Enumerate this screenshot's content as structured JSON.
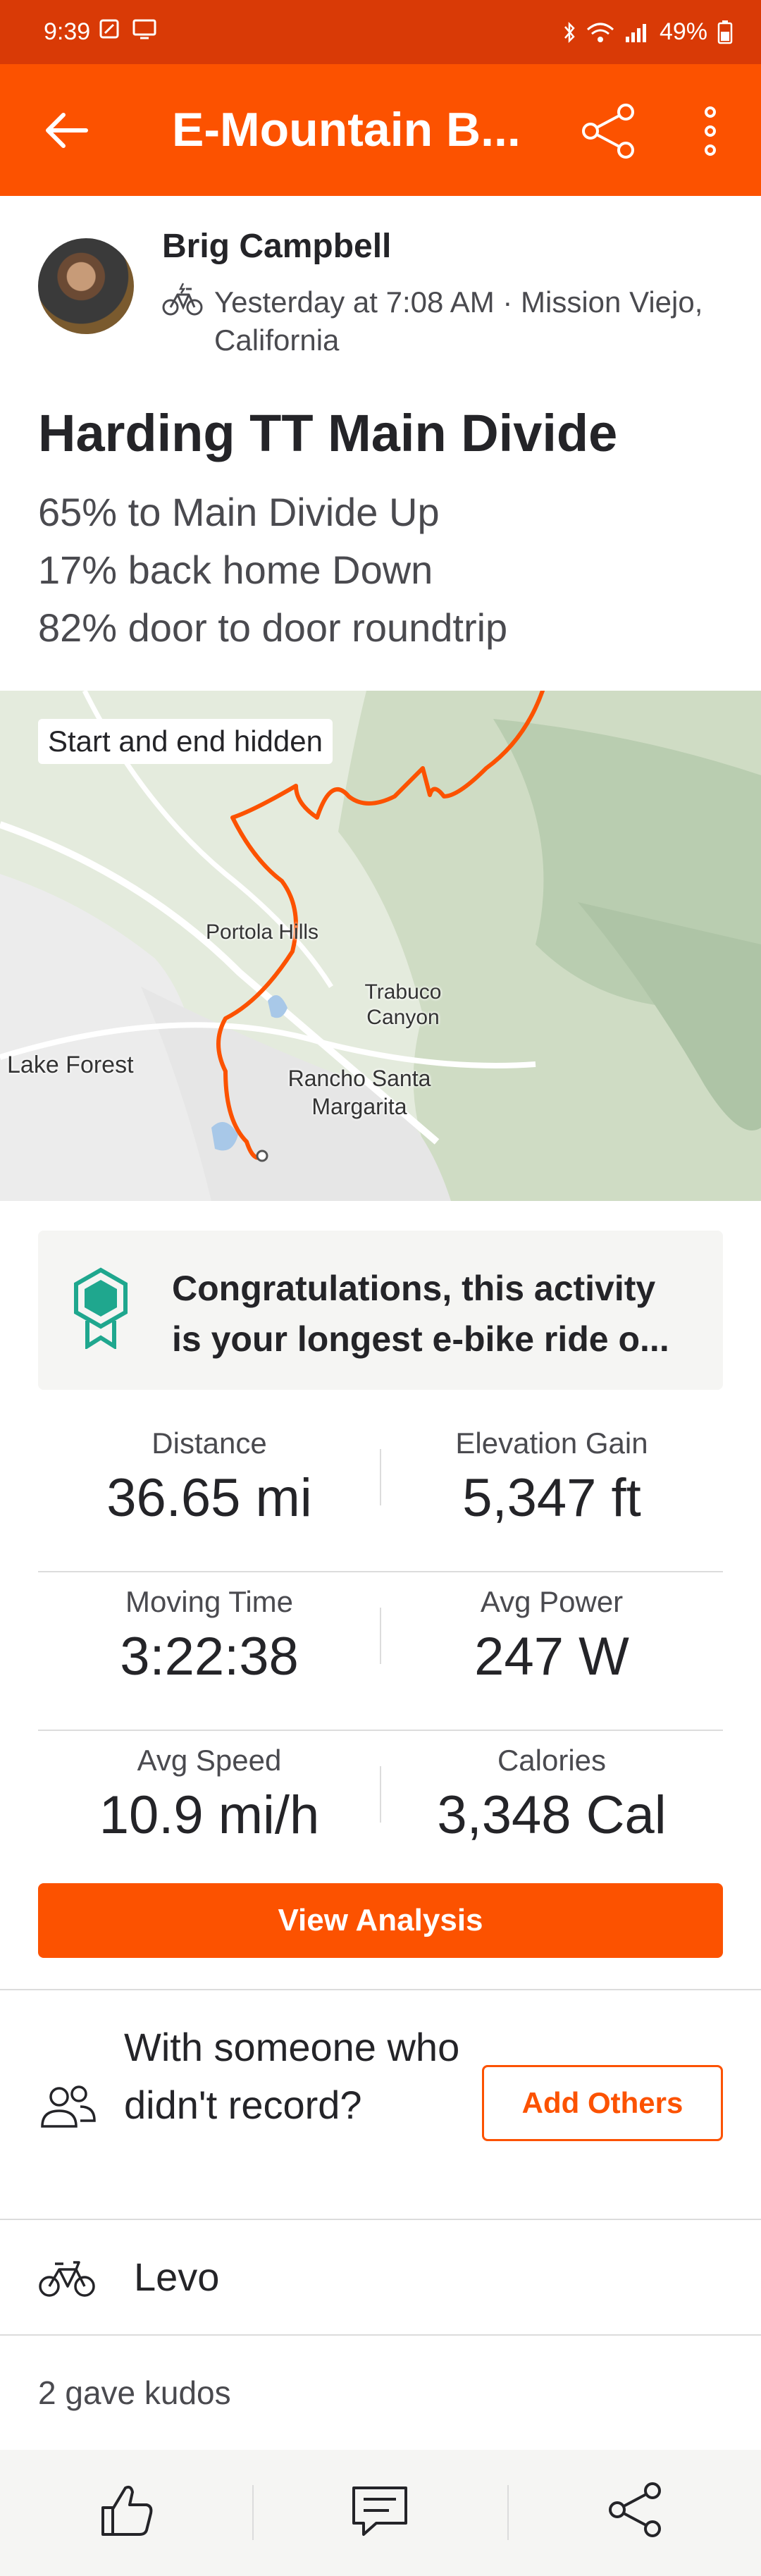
{
  "status_bar": {
    "time": "9:39",
    "battery": "49%"
  },
  "app_bar": {
    "title": "E-Mountain B..."
  },
  "athlete": {
    "name": "Brig Campbell",
    "meta": "Yesterday at 7:08 AM · Mission Viejo, California"
  },
  "activity": {
    "title": "Harding TT Main Divide",
    "description_lines": [
      "65% to Main Divide Up",
      "17% back home Down",
      "82% door to door roundtrip"
    ]
  },
  "map": {
    "badge": "Start and end hidden",
    "labels": {
      "portola_hills": "Portola Hills",
      "trabuco": "Trabuco Canyon",
      "lake_forest": "Lake Forest",
      "rancho": "Rancho Santa Margarita"
    }
  },
  "achievement": {
    "line1": "Congratulations, this activity",
    "line2": "is your longest e-bike ride o..."
  },
  "stats": [
    {
      "left_label": "Distance",
      "left_value": "36.65 mi",
      "right_label": "Elevation Gain",
      "right_value": "5,347 ft"
    },
    {
      "left_label": "Moving Time",
      "left_value": "3:22:38",
      "right_label": "Avg Power",
      "right_value": "247 W"
    },
    {
      "left_label": "Avg Speed",
      "left_value": "10.9 mi/h",
      "right_label": "Calories",
      "right_value": "3,348 Cal"
    }
  ],
  "buttons": {
    "view_analysis": "View Analysis",
    "add_others": "Add Others"
  },
  "with_others": {
    "text": "With someone who didn't record?"
  },
  "gear": {
    "name": "Levo"
  },
  "kudos": {
    "text": "2 gave kudos"
  },
  "colors": {
    "brand": "#fc5200",
    "status_bar": "#d93a06",
    "achievement_icon": "#1fa78e"
  },
  "icons": {
    "back": "arrow-left-icon",
    "share": "share-icon",
    "more": "more-vertical-icon",
    "ebike": "ebike-icon",
    "badge": "badge-icon",
    "people": "people-icon",
    "bike": "bike-icon",
    "kudos": "thumbs-up-icon",
    "comment": "comment-icon"
  }
}
